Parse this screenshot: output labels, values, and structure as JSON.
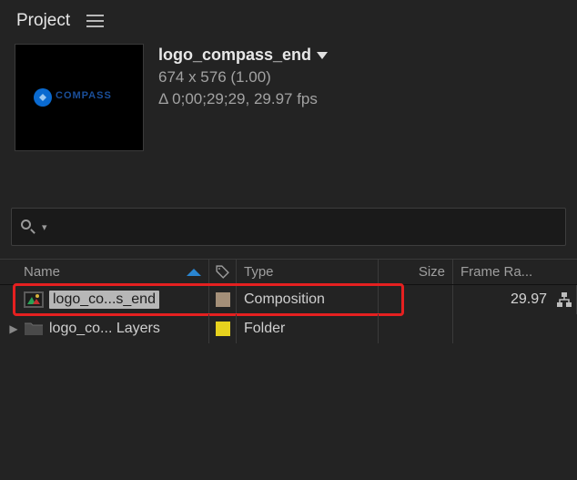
{
  "panel": {
    "title": "Project"
  },
  "preview": {
    "name": "logo_compass_end",
    "dims": "674 x 576 (1.00)",
    "duration": "Δ 0;00;29;29, 29.97 fps",
    "logo_text": "COMPASS",
    "logo_sub": ""
  },
  "search": {
    "placeholder": ""
  },
  "columns": {
    "name": "Name",
    "type": "Type",
    "size": "Size",
    "fps": "Frame Ra..."
  },
  "items": [
    {
      "name": "logo_co...s_end",
      "type": "Composition",
      "size": "",
      "fps": "29.97",
      "label_color": "#a48f78",
      "expandable": false
    },
    {
      "name": "logo_co... Layers",
      "type": "Folder",
      "size": "",
      "fps": "",
      "label_color": "#e7d21e",
      "expandable": true
    }
  ]
}
